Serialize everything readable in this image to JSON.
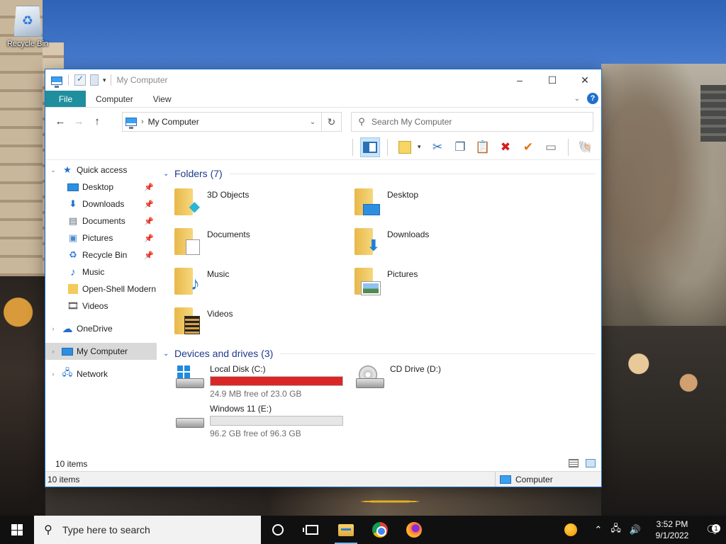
{
  "desktop": {
    "icons": [
      {
        "label": "Recycle Bin",
        "icon": "recycle-bin-icon"
      }
    ]
  },
  "window": {
    "title": "My Computer",
    "quick_access_toolbar": [
      "computer-icon",
      "properties-icon",
      "new-folder-icon",
      "customize-dropdown-icon"
    ],
    "controls": {
      "minimize": "–",
      "maximize": "☐",
      "close": "✕"
    }
  },
  "ribbon": {
    "tabs": [
      "File",
      "Computer",
      "View"
    ],
    "active_tab": "File",
    "accent": "#1f8f9e"
  },
  "navigation": {
    "back": "←",
    "forward": "→",
    "up": "↑",
    "address": {
      "path": "My Computer",
      "separator": "›"
    },
    "refresh": "↻",
    "search_placeholder": "Search My Computer"
  },
  "toolbar": {
    "buttons": [
      "navigation-pane-icon",
      "notes-icon",
      "cut-icon",
      "copy-icon",
      "paste-icon",
      "delete-icon",
      "check-icon",
      "rename-icon",
      "shell-icon"
    ]
  },
  "nav_pane": {
    "quick_access": {
      "label": "Quick access",
      "expanded": true
    },
    "quick_items": [
      {
        "label": "Desktop",
        "pinned": true
      },
      {
        "label": "Downloads",
        "pinned": true
      },
      {
        "label": "Documents",
        "pinned": true
      },
      {
        "label": "Pictures",
        "pinned": true
      },
      {
        "label": "Recycle Bin",
        "pinned": true
      },
      {
        "label": "Music",
        "pinned": false
      },
      {
        "label": "Open-Shell Modern",
        "pinned": false
      },
      {
        "label": "Videos",
        "pinned": false
      }
    ],
    "roots": [
      {
        "label": "OneDrive"
      },
      {
        "label": "My Computer",
        "selected": true
      },
      {
        "label": "Network"
      }
    ]
  },
  "content": {
    "folders_header": "Folders (7)",
    "folders": [
      {
        "name": "3D Objects",
        "icon": "3d-objects-icon"
      },
      {
        "name": "Desktop",
        "icon": "desktop-icon"
      },
      {
        "name": "Documents",
        "icon": "documents-icon"
      },
      {
        "name": "Downloads",
        "icon": "downloads-icon"
      },
      {
        "name": "Music",
        "icon": "music-icon"
      },
      {
        "name": "Pictures",
        "icon": "pictures-icon"
      },
      {
        "name": "Videos",
        "icon": "videos-icon"
      }
    ],
    "drives_header": "Devices and drives (3)",
    "drives": [
      {
        "name": "Local Disk (C:)",
        "free": "24.9 MB free of 23.0 GB",
        "used_fraction": 1.0,
        "bar_color": "#da2626"
      },
      {
        "name": "CD Drive (D:)"
      },
      {
        "name": "Windows 11 (E:)",
        "free": "96.2 GB free of 96.3 GB",
        "used_fraction": 0.0,
        "bar_color": "#26a0da"
      }
    ]
  },
  "status": {
    "inner_count": "10 items",
    "bar_count": "10 items",
    "location": "Computer"
  },
  "taskbar": {
    "search_placeholder": "Type here to search",
    "apps": [
      "cortana-icon",
      "task-view-icon",
      "file-explorer-icon",
      "chrome-icon",
      "firefox-icon"
    ],
    "time": "3:52 PM",
    "date": "9/1/2022",
    "notification_count": "1"
  }
}
